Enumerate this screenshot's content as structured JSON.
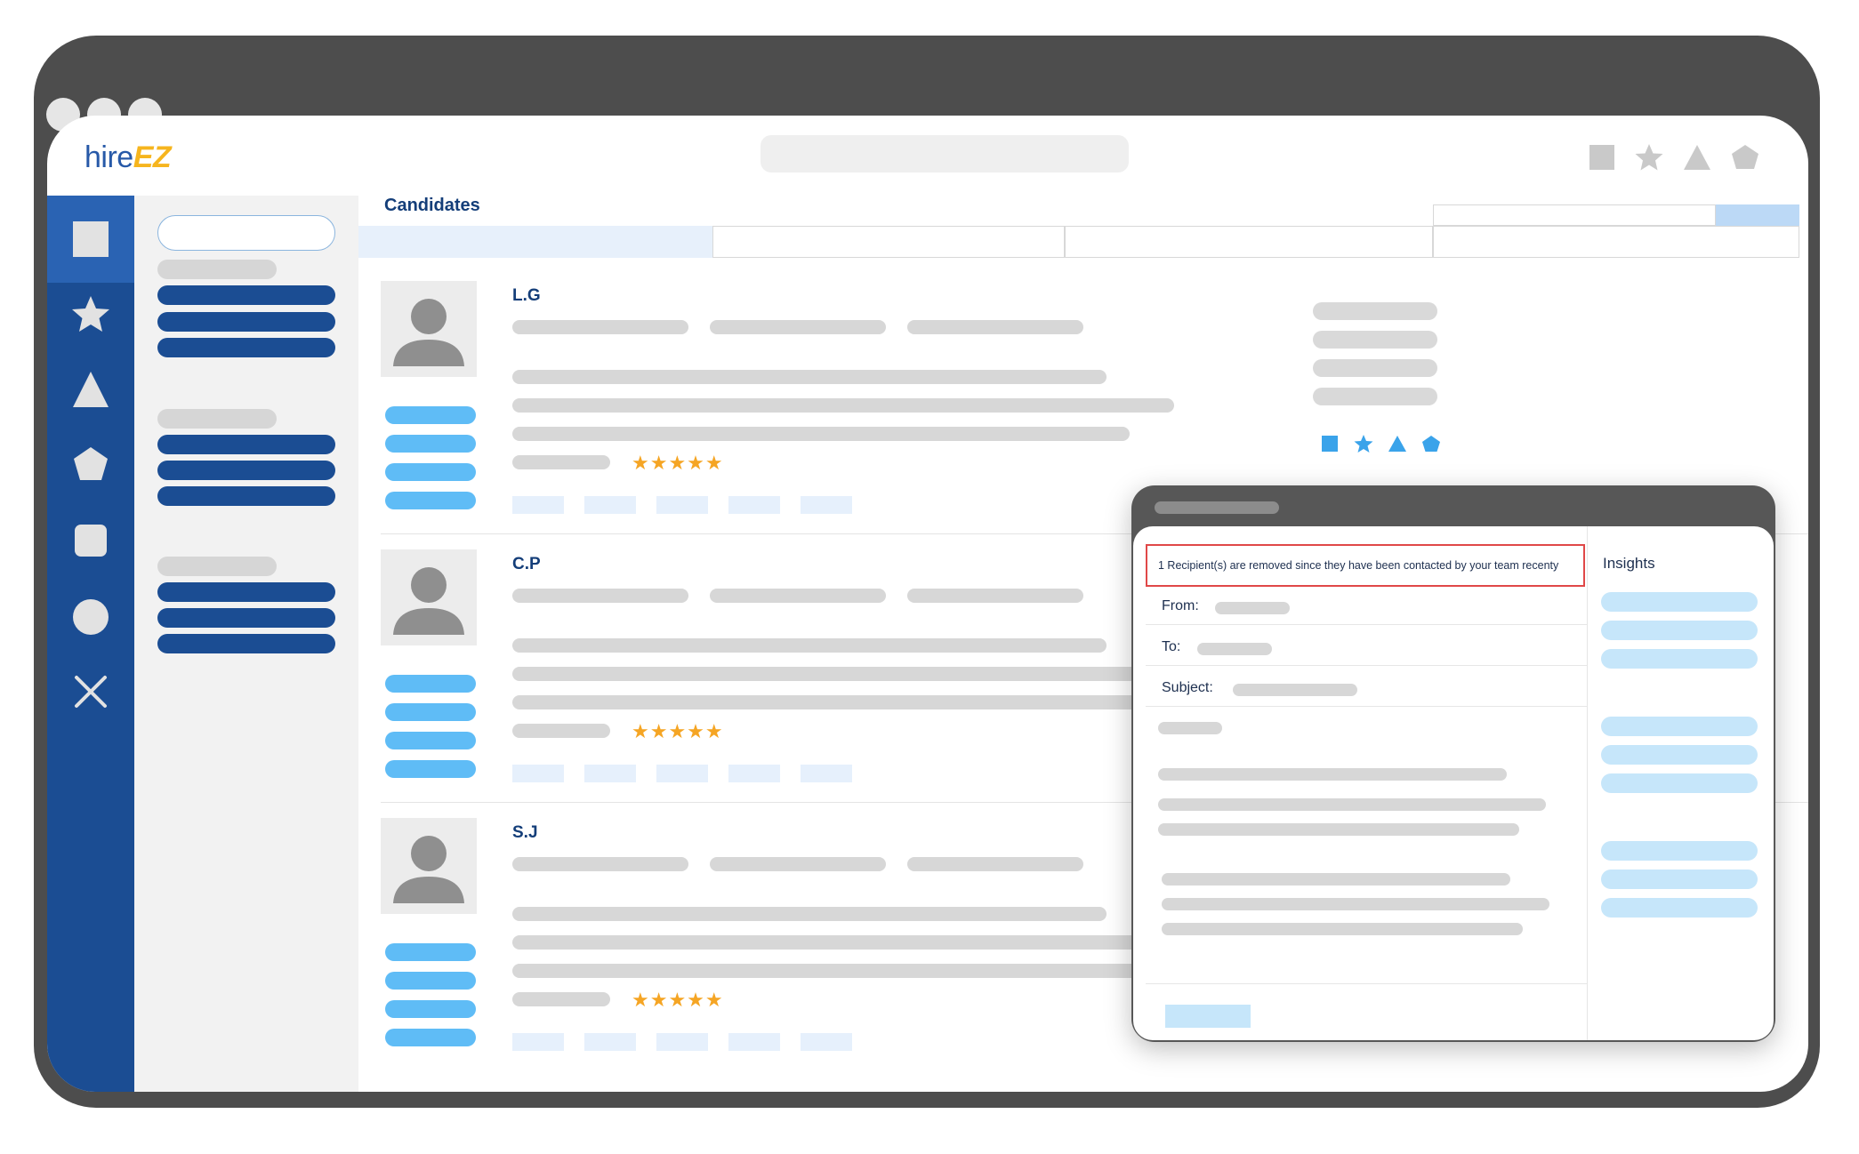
{
  "brand": {
    "logo_part1": "hire",
    "logo_part2": "EZ"
  },
  "toolbar_icons": [
    "square-icon",
    "star-icon",
    "triangle-icon",
    "pentagon-icon"
  ],
  "rail_icons": [
    "square-icon",
    "star-icon",
    "triangle-icon",
    "pentagon-icon",
    "rounded-square-icon",
    "circle-icon",
    "close-icon"
  ],
  "page": {
    "title": "Candidates"
  },
  "candidates": [
    {
      "name": "L.G",
      "rating": "★★★★★"
    },
    {
      "name": "C.P",
      "rating": "★★★★★"
    },
    {
      "name": "S.J",
      "rating": "★★★★★"
    }
  ],
  "email_modal": {
    "alert": "1 Recipient(s) are removed since they have been contacted by your team recenty",
    "from_label": "From:",
    "to_label": "To:",
    "subject_label": "Subject:",
    "insights_label": "Insights"
  },
  "colors": {
    "rail": "#1b4d93",
    "accent_light_blue": "#5fbcf6",
    "title_navy": "#143e79",
    "star_orange": "#f5a524",
    "alert_border": "#e04848"
  }
}
